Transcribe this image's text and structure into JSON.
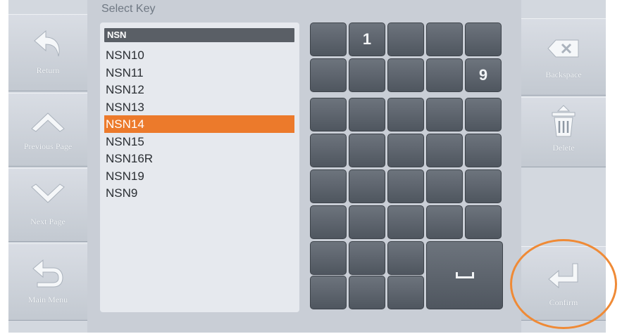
{
  "title": "Select Key",
  "search": {
    "value": "NSN"
  },
  "keys": [
    "NSN10",
    "NSN11",
    "NSN12",
    "NSN13",
    "NSN14",
    "NSN15",
    "NSN16R",
    "NSN19",
    "NSN9"
  ],
  "selected_key": "NSN14",
  "left_buttons": {
    "return": "Return",
    "previous_page": "Previous Page",
    "next_page": "Next Page",
    "main_menu": "Main Menu"
  },
  "right_buttons": {
    "backspace": "Backspace",
    "delete": "Delete",
    "confirm": "Confirm"
  },
  "keypad": {
    "key_1": "1",
    "key_9": "9"
  },
  "colors": {
    "accent": "#ec7a2b",
    "highlight_ring": "#ef8a36",
    "key_face": "#5e656e",
    "panel": "#e6e9ee"
  },
  "icons": {
    "return": "return-arrow-icon",
    "previous_page": "chevron-up-icon",
    "next_page": "chevron-down-icon",
    "main_menu": "u-turn-arrow-icon",
    "backspace": "backspace-icon",
    "delete": "trash-icon",
    "confirm": "enter-arrow-icon",
    "space": "space-bar-icon"
  }
}
